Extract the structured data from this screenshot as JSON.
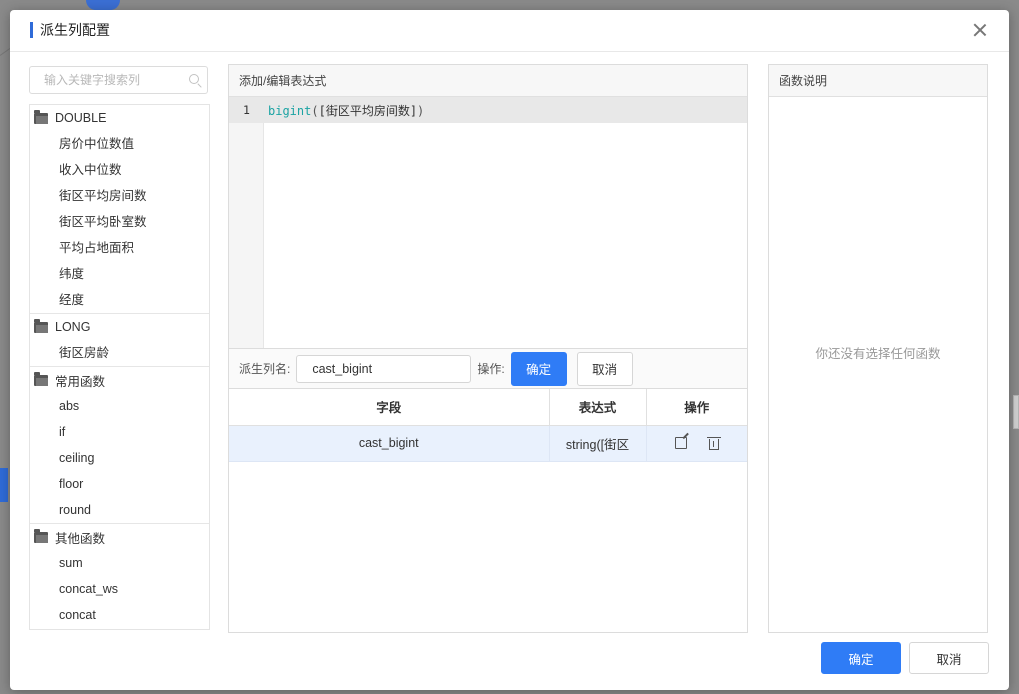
{
  "dialog": {
    "title": "派生列配置"
  },
  "search": {
    "placeholder": "输入关键字搜索列"
  },
  "tree": {
    "groups": [
      {
        "name": "DOUBLE",
        "items": [
          "房价中位数值",
          "收入中位数",
          "街区平均房间数",
          "街区平均卧室数",
          "平均占地面积",
          "纬度",
          "经度"
        ]
      },
      {
        "name": "LONG",
        "items": [
          "街区房龄"
        ]
      },
      {
        "name": "常用函数",
        "items": [
          "abs",
          "if",
          "ceiling",
          "floor",
          "round"
        ]
      },
      {
        "name": "其他函数",
        "items": [
          "sum",
          "concat_ws",
          "concat"
        ]
      }
    ]
  },
  "editor": {
    "title": "添加/编辑表达式",
    "line_number": "1",
    "code_fn": "bigint",
    "code_open": "(",
    "code_arg": "[街区平均房间数]",
    "code_close": ")"
  },
  "name_row": {
    "label": "派生列名:",
    "value": "cast_bigint",
    "op_label": "操作:",
    "confirm": "确定",
    "cancel": "取消"
  },
  "table": {
    "headers": [
      "字段",
      "表达式",
      "操作"
    ],
    "rows": [
      {
        "field": "cast_bigint",
        "expression": "string([街区"
      }
    ]
  },
  "help": {
    "title": "函数说明",
    "empty": "你还没有选择任何函数"
  },
  "footer": {
    "ok": "确定",
    "cancel": "取消"
  },
  "colors": {
    "primary": "#2f7cf6",
    "accent_bar": "#2f6bd8",
    "row_selected": "#e9f1fd",
    "code_fn": "#1ba3a3"
  }
}
